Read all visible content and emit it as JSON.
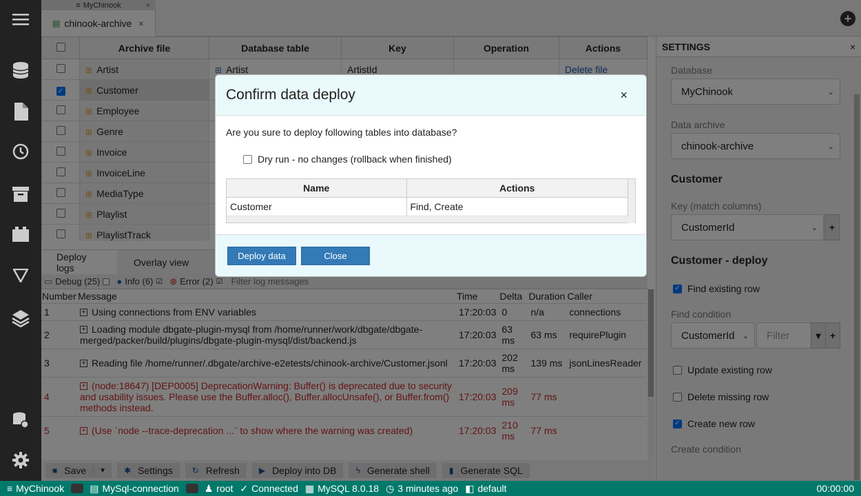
{
  "app": {
    "small_tab": "MyChinook",
    "main_tab": "chinook-archive"
  },
  "grid": {
    "headers": [
      "Archive file",
      "Database table",
      "Key",
      "Operation",
      "Actions"
    ],
    "rows": [
      {
        "file": "Artist",
        "table": "Artist",
        "key": "ArtistId",
        "operation": "",
        "action": "Delete file",
        "checked": false
      },
      {
        "file": "Customer",
        "table": "",
        "key": "",
        "operation": "",
        "action": "",
        "checked": true
      },
      {
        "file": "Employee",
        "table": "",
        "key": "",
        "operation": "",
        "action": "",
        "checked": false
      },
      {
        "file": "Genre",
        "table": "",
        "key": "",
        "operation": "",
        "action": "",
        "checked": false
      },
      {
        "file": "Invoice",
        "table": "",
        "key": "",
        "operation": "",
        "action": "",
        "checked": false
      },
      {
        "file": "InvoiceLine",
        "table": "",
        "key": "",
        "operation": "",
        "action": "",
        "checked": false
      },
      {
        "file": "MediaType",
        "table": "",
        "key": "",
        "operation": "",
        "action": "",
        "checked": false
      },
      {
        "file": "Playlist",
        "table": "",
        "key": "",
        "operation": "",
        "action": "",
        "checked": false
      },
      {
        "file": "PlaylistTrack",
        "table": "",
        "key": "",
        "operation": "",
        "action": "",
        "checked": false
      }
    ]
  },
  "logtabs": [
    "Deploy logs",
    "Overlay view"
  ],
  "logfilters": {
    "debug": "Debug (25)",
    "info": "Info (6)",
    "error": "Error (2)",
    "placeholder": "Filter log messages"
  },
  "logs": {
    "headers": [
      "Number",
      "Message",
      "Time",
      "Delta",
      "Duration",
      "Caller"
    ],
    "rows": [
      {
        "num": "1",
        "msg": "Using connections from ENV variables",
        "time": "17:20:03",
        "delta": "0",
        "duration": "n/a",
        "caller": "connections",
        "error": false
      },
      {
        "num": "2",
        "msg": "Loading module dbgate-plugin-mysql from /home/runner/work/dbgate/dbgate-merged/packer/build/plugins/dbgate-plugin-mysql/dist/backend.js",
        "time": "17:20:03",
        "delta": "63 ms",
        "duration": "63 ms",
        "caller": "requirePlugin",
        "error": false
      },
      {
        "num": "3",
        "msg": "Reading file /home/runner/.dbgate/archive-e2etests/chinook-archive/Customer.jsonl",
        "time": "17:20:03",
        "delta": "202 ms",
        "duration": "139 ms",
        "caller": "jsonLinesReader",
        "error": false
      },
      {
        "num": "4",
        "msg": "(node:18647) [DEP0005] DeprecationWarning: Buffer() is deprecated due to security and usability issues. Please use the Buffer.alloc(), Buffer.allocUnsafe(), or Buffer.from() methods instead.",
        "time": "17:20:03",
        "delta": "209 ms",
        "duration": "77 ms",
        "caller": "",
        "error": true
      },
      {
        "num": "5",
        "msg": "(Use `node --trace-deprecation ...` to show where the warning was created)",
        "time": "17:20:03",
        "delta": "210 ms",
        "duration": "77 ms",
        "caller": "",
        "error": true
      }
    ]
  },
  "toolbar": {
    "save": "Save",
    "settings": "Settings",
    "refresh": "Refresh",
    "deploy": "Deploy into DB",
    "shell": "Generate shell",
    "sql": "Generate SQL"
  },
  "status": {
    "db": "MyChinook",
    "connection": "MySql-connection",
    "user": "root",
    "state": "Connected",
    "version": "MySQL 8.0.18",
    "time_ago": "3 minutes ago",
    "schema": "default",
    "timer": "00:00:00"
  },
  "settings": {
    "title": "SETTINGS",
    "database_label": "Database",
    "database_value": "MyChinook",
    "archive_label": "Data archive",
    "archive_value": "chinook-archive",
    "table_heading": "Customer",
    "key_label": "Key (match columns)",
    "key_value": "CustomerId",
    "deploy_heading": "Customer - deploy",
    "find_existing": "Find existing row",
    "find_condition_label": "Find condition",
    "find_condition_value": "CustomerId",
    "filter_placeholder": "Filter",
    "update_existing": "Update existing row",
    "delete_missing": "Delete missing row",
    "create_new": "Create new row",
    "create_condition_label": "Create condition"
  },
  "modal": {
    "title": "Confirm data deploy",
    "question": "Are you sure to deploy following tables into database?",
    "dry_run": "Dry run - no changes (rollback when finished)",
    "table_headers": [
      "Name",
      "Actions"
    ],
    "table_rows": [
      {
        "name": "Customer",
        "actions": "Find, Create"
      }
    ],
    "deploy_button": "Deploy data",
    "close_button": "Close"
  }
}
